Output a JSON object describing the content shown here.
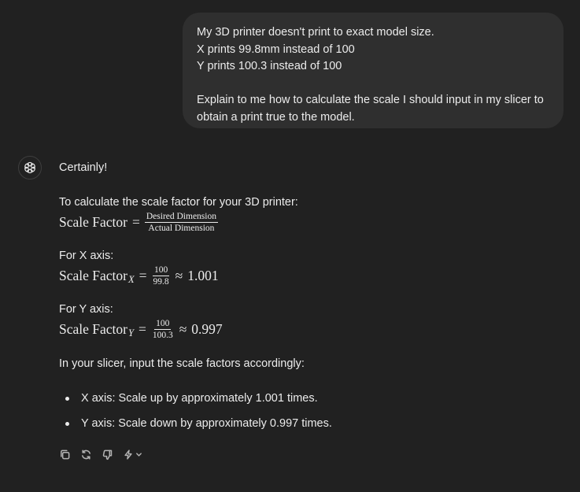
{
  "user_message": {
    "lines": [
      "My 3D printer doesn't print to exact model size.",
      "X prints 99.8mm instead of 100",
      "Y prints 100.3 instead of 100",
      "Explain to me how to calculate the scale I should input in my slicer to",
      "obtain a print true to the model."
    ]
  },
  "assistant": {
    "greeting": "Certainly!",
    "intro": "To calculate the scale factor for your 3D printer:",
    "formula": {
      "lhs": "Scale Factor",
      "eq": "=",
      "num": "Desired Dimension",
      "den": "Actual Dimension"
    },
    "x_axis": {
      "heading": "For X axis:",
      "lhs": "Scale Factor",
      "sub": "X",
      "eq": "=",
      "num": "100",
      "den": "99.8",
      "approx": "≈",
      "result": "1.001"
    },
    "y_axis": {
      "heading": "For Y axis:",
      "lhs": "Scale Factor",
      "sub": "Y",
      "eq": "=",
      "num": "100",
      "den": "100.3",
      "approx": "≈",
      "result": "0.997"
    },
    "slicer_text": "In your slicer, input the scale factors accordingly:",
    "bullets": [
      "X axis: Scale up by approximately 1.001 times.",
      "Y axis: Scale down by approximately 0.997 times."
    ]
  },
  "actions": {
    "icons": [
      "copy-icon",
      "regenerate-icon",
      "thumbs-down-icon",
      "model-switch-icon",
      "chevron-down-icon"
    ]
  },
  "colors": {
    "background": "#212121",
    "user_bubble": "#2f2f2f",
    "text": "#ececec",
    "icon": "#b4b4b4"
  }
}
